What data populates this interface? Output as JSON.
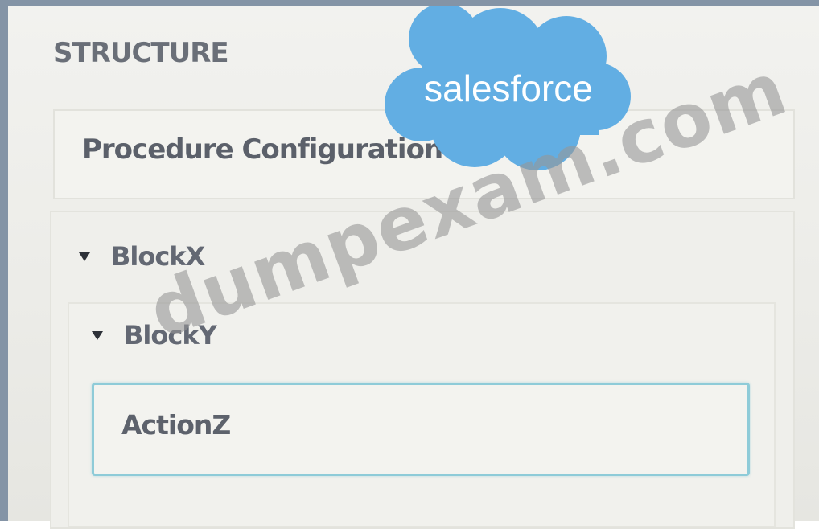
{
  "structure": {
    "title": "STRUCTURE",
    "procedure_label": "Procedure Configuration",
    "block_x": {
      "label": "BlockX",
      "expanded": true,
      "icon": "caret-down-icon"
    },
    "block_y": {
      "label": "BlockY",
      "expanded": true,
      "icon": "caret-down-icon"
    },
    "action": {
      "label": "ActionZ",
      "selected": true
    }
  },
  "overlays": {
    "logo_text": "salesforce",
    "logo_color": "#62aee3",
    "watermark_text": "dumpexam.com"
  },
  "colors": {
    "frame": "#8494a6",
    "selection_border": "#8ecbd8"
  }
}
